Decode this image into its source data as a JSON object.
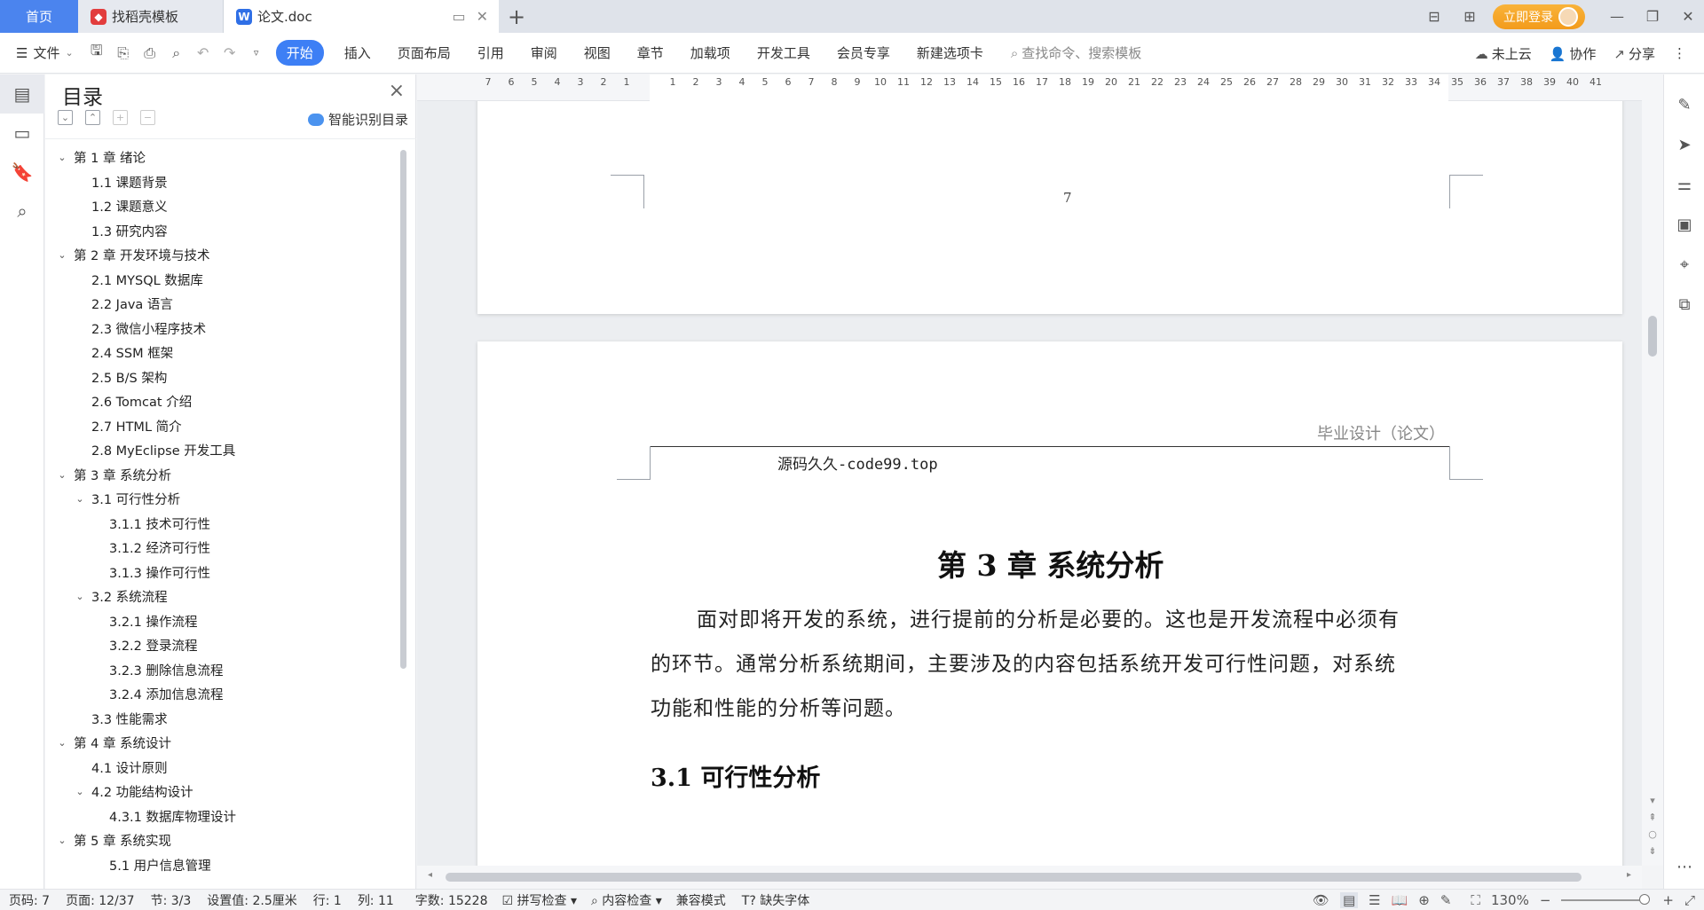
{
  "tabs": [
    {
      "label": "首页"
    },
    {
      "label": "找稻壳模板",
      "icon": "docer-icon"
    },
    {
      "label": "论文.doc",
      "icon": "wps-writer-icon"
    }
  ],
  "window": {
    "login_label": "立即登录"
  },
  "menu": {
    "file_label": "文件",
    "tabs": [
      "开始",
      "插入",
      "页面布局",
      "引用",
      "审阅",
      "视图",
      "章节",
      "加载项",
      "开发工具",
      "会员专享",
      "新建选项卡"
    ],
    "search_placeholder": "查找命令、搜索模板",
    "right": {
      "cloud": "未上云",
      "collab": "协作",
      "share": "分享"
    }
  },
  "toc": {
    "title": "目录",
    "smart_label": "智能识别目录",
    "items": [
      {
        "level": 1,
        "text": "第 1 章  绪论",
        "expanded": true
      },
      {
        "level": 2,
        "text": "1.1  课题背景"
      },
      {
        "level": 2,
        "text": "1.2  课题意义"
      },
      {
        "level": 2,
        "text": "1.3  研究内容"
      },
      {
        "level": 1,
        "text": "第 2 章  开发环境与技术",
        "expanded": true
      },
      {
        "level": 2,
        "text": "2.1 MYSQL 数据库"
      },
      {
        "level": 2,
        "text": "2.2 Java 语言"
      },
      {
        "level": 2,
        "text": "2.3  微信小程序技术"
      },
      {
        "level": 2,
        "text": "2.4 SSM 框架"
      },
      {
        "level": 2,
        "text": "2.5 B/S 架构"
      },
      {
        "level": 2,
        "text": "2.6 Tomcat  介绍"
      },
      {
        "level": 2,
        "text": "2.7 HTML 简介"
      },
      {
        "level": 2,
        "text": "2.8 MyEclipse 开发工具"
      },
      {
        "level": 1,
        "text": "第 3 章  系统分析",
        "expanded": true
      },
      {
        "level": 2,
        "text": "3.1  可行性分析",
        "expanded": true
      },
      {
        "level": 3,
        "text": "3.1.1  技术可行性"
      },
      {
        "level": 3,
        "text": "3.1.2  经济可行性"
      },
      {
        "level": 3,
        "text": "3.1.3  操作可行性"
      },
      {
        "level": 2,
        "text": "3.2  系统流程",
        "expanded": true
      },
      {
        "level": 3,
        "text": "3.2.1  操作流程"
      },
      {
        "level": 3,
        "text": "3.2.2  登录流程"
      },
      {
        "level": 3,
        "text": "3.2.3  删除信息流程"
      },
      {
        "level": 3,
        "text": "3.2.4  添加信息流程"
      },
      {
        "level": 2,
        "text": "3.3  性能需求"
      },
      {
        "level": 1,
        "text": "第 4 章  系统设计",
        "expanded": true
      },
      {
        "level": 2,
        "text": "4.1  设计原则"
      },
      {
        "level": 2,
        "text": "4.2  功能结构设计",
        "expanded": true
      },
      {
        "level": 3,
        "text": "4.3.1  数据库物理设计"
      },
      {
        "level": 1,
        "text": "第 5 章  系统实现",
        "expanded": true
      },
      {
        "level": 3,
        "text": "5.1 用户信息管理"
      }
    ]
  },
  "ruler": {
    "labels": [
      "7",
      "6",
      "5",
      "4",
      "3",
      "2",
      "1",
      "",
      "1",
      "2",
      "3",
      "4",
      "5",
      "6",
      "7",
      "8",
      "9",
      "10",
      "11",
      "12",
      "13",
      "14",
      "15",
      "16",
      "17",
      "18",
      "19",
      "20",
      "21",
      "22",
      "23",
      "24",
      "25",
      "26",
      "27",
      "28",
      "29",
      "30",
      "31",
      "32",
      "33",
      "34",
      "35",
      "36",
      "37",
      "38",
      "39",
      "40",
      "41"
    ]
  },
  "document": {
    "prev_page_number": "7",
    "header_right": "毕业设计（论文）",
    "header_source": "源码久久-code99.top",
    "chapter_title": "第 3 章  系统分析",
    "paragraph": "面对即将开发的系统，进行提前的分析是必要的。这也是开发流程中必须有的环节。通常分析系统期间，主要涉及的内容包括系统开发可行性问题，对系统功能和性能的分析等问题。",
    "para_lines": [
      "面对即将开发的系统，进行提前的分析是必要的。这也是开发流程中必须有",
      "的环节。通常分析系统期间，主要涉及的内容包括系统开发可行性问题，对系统",
      "功能和性能的分析等问题。"
    ],
    "section_title": "3.1  可行性分析"
  },
  "status": {
    "page_code": "页码: 7",
    "page": "页面: 12/37",
    "section": "节: 3/3",
    "setting": "设置值: 2.5厘米",
    "line": "行: 1",
    "col": "列: 11",
    "words": "字数: 15228",
    "spell": "拼写检查",
    "content_check": "内容检查",
    "compat": "兼容模式",
    "missing_font": "缺失字体",
    "zoom": "130%"
  }
}
